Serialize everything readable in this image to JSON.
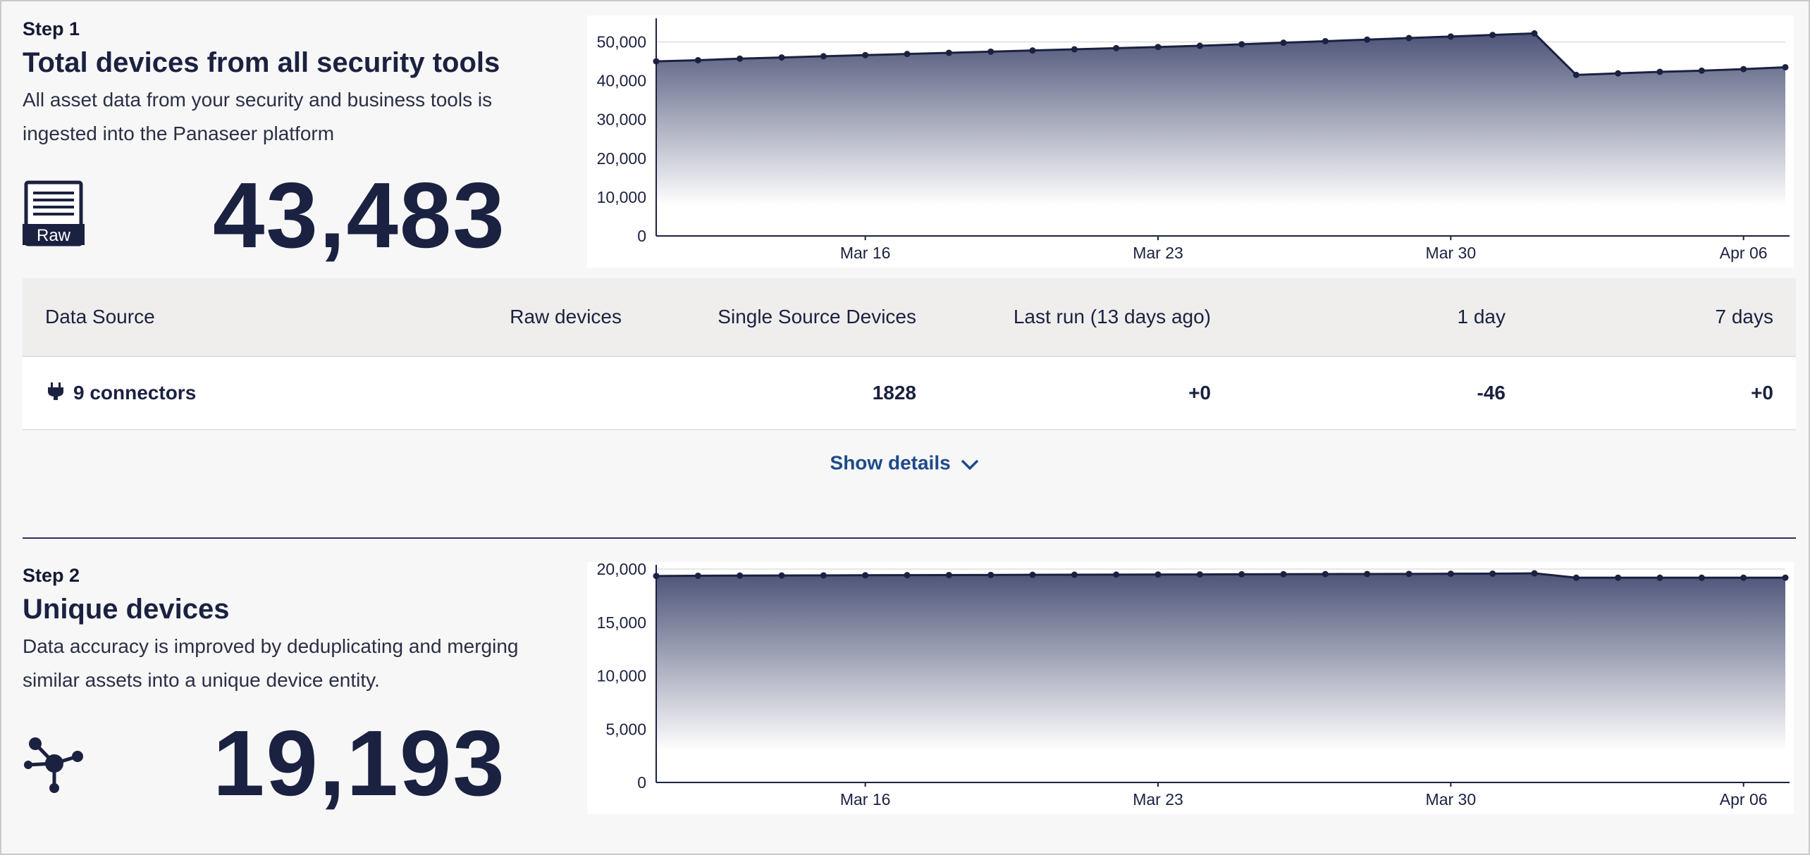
{
  "step1": {
    "label": "Step 1",
    "title": "Total devices from all security tools",
    "description": "All asset data from your security and business tools is ingested into the Panaseer platform",
    "icon_text": "Raw",
    "big_number": "43,483"
  },
  "step2": {
    "label": "Step 2",
    "title": "Unique devices",
    "description": "Data accuracy is improved by deduplicating and merging similar assets into a unique device entity.",
    "big_number": "19,193"
  },
  "table": {
    "headers": [
      "Data Source",
      "Raw devices",
      "Single Source Devices",
      "Last run (13 days ago)",
      "1 day",
      "7 days"
    ],
    "row": {
      "source": "9 connectors",
      "raw_devices": "",
      "single_source": "1828",
      "last_run": "+0",
      "one_day": "-46",
      "seven_days": "+0"
    }
  },
  "show_details_label": "Show details",
  "colors": {
    "accent": "#1b2140",
    "link": "#1d4a8a",
    "area_top": "#4d5478"
  },
  "chart_data": [
    {
      "type": "area",
      "x_ticks": [
        "Mar 16",
        "Mar 23",
        "Mar 30",
        "Apr 06"
      ],
      "y_ticks": [
        "0",
        "10,000",
        "20,000",
        "30,000",
        "40,000",
        "50,000"
      ],
      "ylim": [
        0,
        55000
      ],
      "x": [
        "Mar 11",
        "Mar 12",
        "Mar 13",
        "Mar 14",
        "Mar 15",
        "Mar 16",
        "Mar 17",
        "Mar 18",
        "Mar 19",
        "Mar 20",
        "Mar 21",
        "Mar 22",
        "Mar 23",
        "Mar 24",
        "Mar 25",
        "Mar 26",
        "Mar 27",
        "Mar 28",
        "Mar 29",
        "Mar 30",
        "Mar 31",
        "Apr 01",
        "Apr 02",
        "Apr 03",
        "Apr 04",
        "Apr 05",
        "Apr 06",
        "Apr 07"
      ],
      "values": [
        45000,
        45300,
        45700,
        46000,
        46300,
        46600,
        46900,
        47200,
        47500,
        47800,
        48100,
        48400,
        48700,
        49000,
        49400,
        49800,
        50200,
        50600,
        51000,
        51400,
        51800,
        52200,
        41500,
        41900,
        42300,
        42600,
        43000,
        43483
      ],
      "grid": true
    },
    {
      "type": "area",
      "x_ticks": [
        "Mar 16",
        "Mar 23",
        "Mar 30",
        "Apr 06"
      ],
      "y_ticks": [
        "0",
        "5,000",
        "10,000",
        "15,000",
        "20,000"
      ],
      "ylim": [
        0,
        20000
      ],
      "x": [
        "Mar 11",
        "Mar 12",
        "Mar 13",
        "Mar 14",
        "Mar 15",
        "Mar 16",
        "Mar 17",
        "Mar 18",
        "Mar 19",
        "Mar 20",
        "Mar 21",
        "Mar 22",
        "Mar 23",
        "Mar 24",
        "Mar 25",
        "Mar 26",
        "Mar 27",
        "Mar 28",
        "Mar 29",
        "Mar 30",
        "Mar 31",
        "Apr 01",
        "Apr 02",
        "Apr 03",
        "Apr 04",
        "Apr 05",
        "Apr 06",
        "Apr 07"
      ],
      "values": [
        19350,
        19370,
        19390,
        19400,
        19410,
        19420,
        19430,
        19440,
        19450,
        19460,
        19470,
        19480,
        19490,
        19500,
        19510,
        19520,
        19530,
        19540,
        19550,
        19560,
        19570,
        19600,
        19190,
        19190,
        19190,
        19190,
        19190,
        19193
      ],
      "grid": true
    }
  ]
}
